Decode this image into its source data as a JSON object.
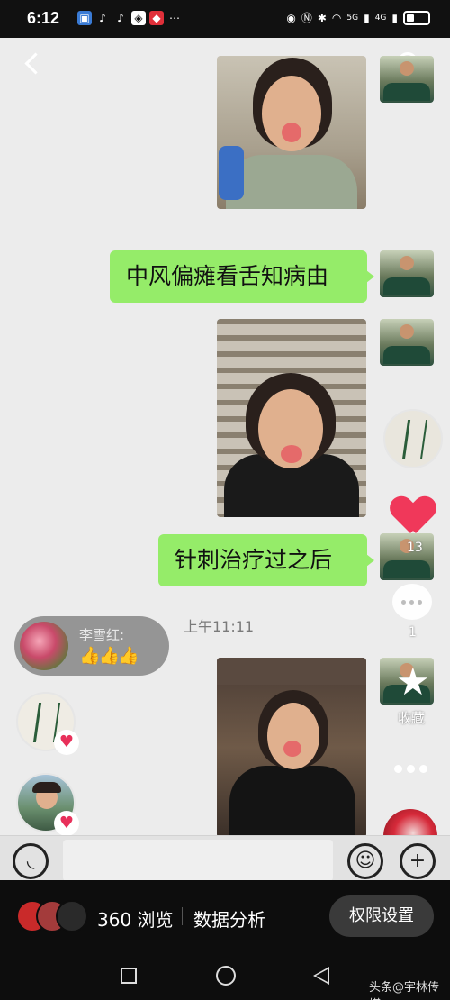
{
  "status_bar": {
    "time": "6:12",
    "network": "5G",
    "network2": "4G",
    "icons": [
      "gallery-icon",
      "tiktok-icon",
      "tiktok-icon",
      "app-icon",
      "app-icon",
      "more-dots-icon",
      "eye-icon",
      "nfc-icon",
      "bluetooth-icon",
      "wifi-icon",
      "signal-icon",
      "battery-icon"
    ]
  },
  "chat": {
    "messages": [
      {
        "type": "image",
        "description": "photo"
      },
      {
        "type": "text",
        "text": "中风偏瘫看舌知病由"
      },
      {
        "type": "image",
        "description": "photo"
      },
      {
        "type": "text",
        "text": "针刺治疗过之后"
      },
      {
        "type": "image",
        "description": "photo"
      }
    ],
    "timestamp": "上午11:11"
  },
  "overlay": {
    "comment": {
      "name": "李雪红:",
      "text": "👍👍👍"
    },
    "likes_count": "13",
    "comments_count": "1",
    "collect_label": "收藏"
  },
  "live_bar": {
    "views": "360 浏览",
    "analysis_label": "数据分析",
    "permission_button": "权限设置"
  },
  "watermark": "头条@宇林传媒",
  "colors": {
    "bubble": "#95ec69",
    "heart": "#f0385a",
    "live_bg": "#0d0d0d"
  }
}
